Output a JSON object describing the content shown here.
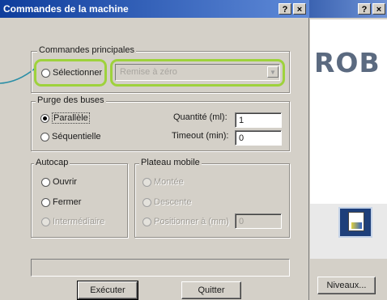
{
  "dialog": {
    "title": "Commandes de la machine",
    "help_button": "?",
    "close_button": "×"
  },
  "background_window": {
    "help_button": "?",
    "close_button": "×",
    "logo_text": "ROB",
    "levels_button": "Niveaux..."
  },
  "main_commands": {
    "legend": "Commandes principales",
    "select_radio": "Sélectionner",
    "combo_value": "Remise à zéro"
  },
  "nozzle_purge": {
    "legend": "Purge des buses",
    "parallel": "Parallèle",
    "sequential": "Séquentielle",
    "quantity_label": "Quantité (ml):",
    "quantity_value": "1",
    "timeout_label": "Timeout (min):",
    "timeout_value": "0"
  },
  "autocap": {
    "legend": "Autocap",
    "open": "Ouvrir",
    "close": "Fermer",
    "intermediate": "Intermédiaire"
  },
  "mobile_plate": {
    "legend": "Plateau mobile",
    "up": "Montée",
    "down": "Descente",
    "position_label": "Positionner à (mm)",
    "position_value": "0"
  },
  "buttons": {
    "execute": "Exécuter",
    "quit": "Quitter"
  },
  "colors": {
    "title_bar": "#0e3d9c",
    "highlight": "#9ed23c",
    "dialog_bg": "#d4d0c8"
  }
}
